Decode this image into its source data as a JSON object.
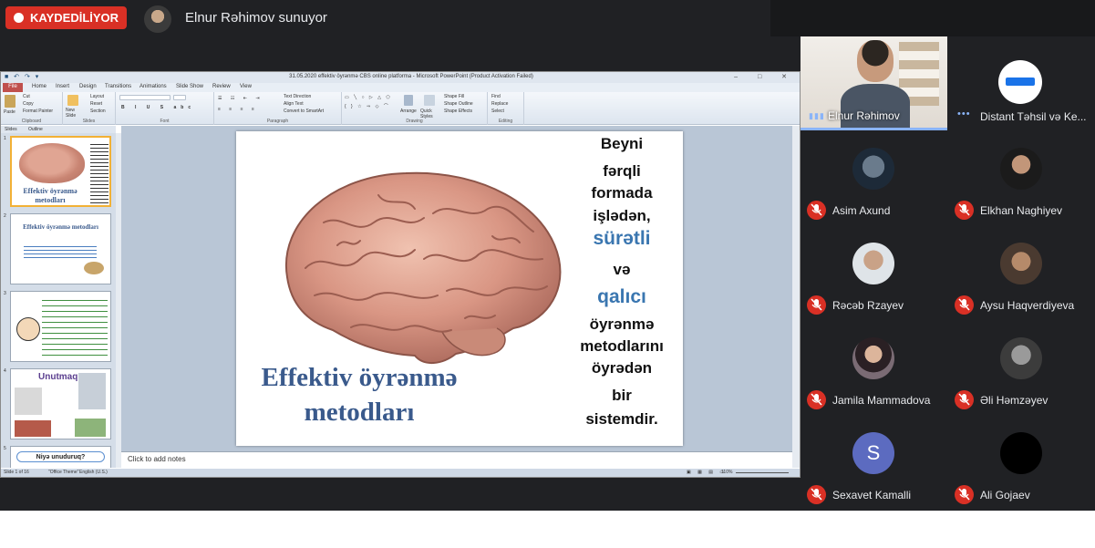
{
  "meeting": {
    "recording_label": "KAYDEDİLİYOR",
    "presenter_label": "Elnur Rəhimov sunuyor"
  },
  "ppt": {
    "window_title": "31.05.2020 effektiv öyrənmə CBS online platforma - Microsoft PowerPoint (Product Activation Failed)",
    "tabs": [
      "File",
      "Home",
      "Insert",
      "Design",
      "Transitions",
      "Animations",
      "Slide Show",
      "Review",
      "View"
    ],
    "ribbon_groups": [
      "Clipboard",
      "Slides",
      "Font",
      "Paragraph",
      "Drawing",
      "Editing"
    ],
    "ribbon_items": {
      "paste": "Paste",
      "cut": "Cut",
      "copy": "Copy",
      "format_painter": "Format Painter",
      "new_slide": "New Slide",
      "layout": "Layout",
      "reset": "Reset",
      "section": "Section",
      "text_direction": "Text Direction",
      "align_text": "Align Text",
      "convert_smartart": "Convert to SmartArt",
      "arrange": "Arrange",
      "quick_styles": "Quick Styles",
      "shape_fill": "Shape Fill",
      "shape_outline": "Shape Outline",
      "shape_effects": "Shape Effects",
      "find": "Find",
      "replace": "Replace",
      "select": "Select"
    },
    "pane_tabs": [
      "Slides",
      "Outline"
    ],
    "thumbnails": [
      {
        "num": "1",
        "title": "Effektiv öyrənmə metodları"
      },
      {
        "num": "2",
        "title": "Effektiv öyrənmə metodları"
      },
      {
        "num": "3",
        "title": ""
      },
      {
        "num": "4",
        "title": "Unutmaq"
      },
      {
        "num": "5",
        "title": "Niyə unuduruq?"
      }
    ],
    "notes_placeholder": "Click to add notes",
    "status": {
      "slide_counter": "Slide 1 of 16",
      "theme": "\"Office Theme\"",
      "language": "English (U.S.)",
      "zoom": "110%"
    }
  },
  "slide": {
    "title_line1": "Effektiv öyrənmə",
    "title_line2": "metodları",
    "words": [
      "Beyni",
      "fərqli",
      "formada",
      "işlədən,",
      "sürətli",
      "və",
      "qalıcı",
      "öyrənmə",
      "metodlarını",
      "öyrədən",
      "bir",
      "sistemdir."
    ]
  },
  "participants": {
    "main": {
      "name": "Elnur Rəhimov"
    },
    "second": {
      "name": "Distant Təhsil və Ke..."
    },
    "list": [
      {
        "name": "Asim Axund",
        "initial": ""
      },
      {
        "name": "Elkhan Naghiyev",
        "initial": ""
      },
      {
        "name": "Rəcəb Rzayev",
        "initial": ""
      },
      {
        "name": "Aysu Haqverdiyeva",
        "initial": ""
      },
      {
        "name": "Jamila Mammadova",
        "initial": ""
      },
      {
        "name": "Əli Həmzəyev",
        "initial": ""
      },
      {
        "name": "Sexavet Kamalli",
        "initial": "S"
      },
      {
        "name": "Ali Gojaev",
        "initial": ""
      }
    ]
  },
  "colors": {
    "recording_red": "#d93025",
    "meet_dark": "#202124",
    "active_speaker": "#8ab4f8",
    "slide_title_blue": "#3a5a8c",
    "slide_accent_blue": "#3a76b0"
  }
}
